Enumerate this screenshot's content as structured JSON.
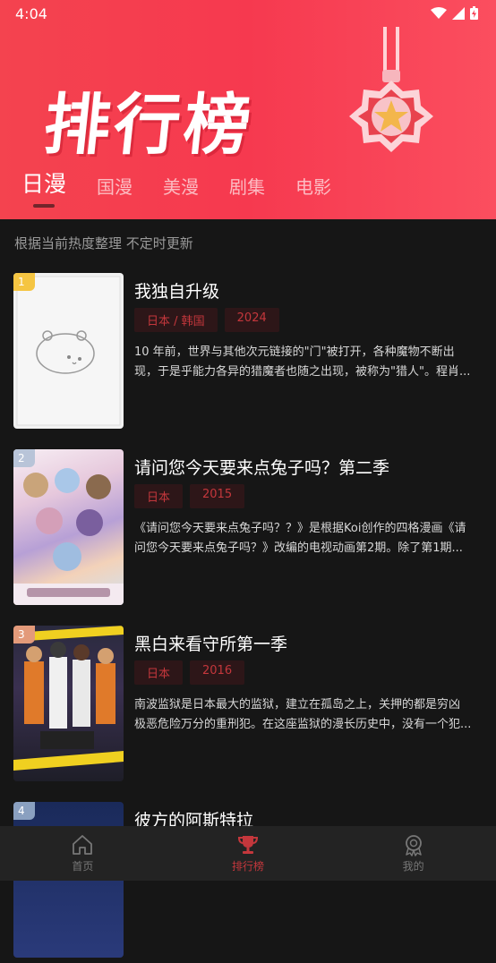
{
  "status": {
    "time": "4:04"
  },
  "header": {
    "title": "排行榜",
    "tabs": [
      {
        "label": "日漫"
      },
      {
        "label": "国漫"
      },
      {
        "label": "美漫"
      },
      {
        "label": "剧集"
      },
      {
        "label": "电影"
      }
    ]
  },
  "subtitle": "根据当前热度整理  不定时更新",
  "items": [
    {
      "rank": "1",
      "title": "我独自升级",
      "region": "日本 / 韩国",
      "year": "2024",
      "desc1": "10 年前，世界与其他次元链接的\"门\"被打开，各种魔物不断出",
      "desc2": "现，于是乎能力各异的猎魔者也随之出现，被称为\"猎人\"。程肖..."
    },
    {
      "rank": "2",
      "title": "请问您今天要来点兔子吗？第二季",
      "region": "日本",
      "year": "2015",
      "desc1": "《请问您今天要来点兔子吗？？》是根据Koi创作的四格漫画《请",
      "desc2": "问您今天要来点兔子吗？》改编的电视动画第2期。除了第1期..."
    },
    {
      "rank": "3",
      "title": "黑白来看守所第一季",
      "region": "日本",
      "year": "2016",
      "desc1": "南波监狱是日本最大的监狱，建立在孤岛之上，关押的都是穷凶",
      "desc2": "极恶危险万分的重刑犯。在这座监狱的漫长历史中，没有一个犯..."
    },
    {
      "rank": "4",
      "title": "彼方的阿斯特拉",
      "region": "",
      "year": "",
      "desc1": "",
      "desc2": ""
    }
  ],
  "nav": [
    {
      "label": "首页",
      "icon": "home-icon"
    },
    {
      "label": "排行榜",
      "icon": "trophy-icon"
    },
    {
      "label": "我的",
      "icon": "profile-icon"
    }
  ],
  "colors": {
    "accent": "#c4373c",
    "header": "#f6394f",
    "rank1": "#f5c542",
    "rank2": "#b8c4d8",
    "rank3": "#e39a7a",
    "rank4": "#8aa0c0"
  }
}
